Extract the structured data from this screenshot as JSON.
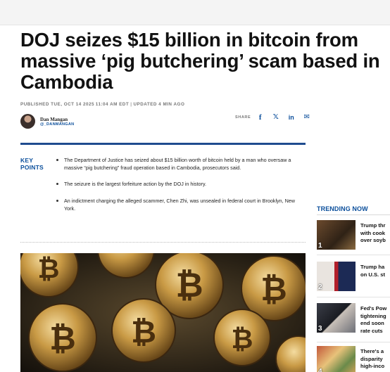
{
  "article": {
    "headline": "DOJ seizes $15 billion in bitcoin from massive ‘pig butchering’ scam based in Cambodia",
    "published": "PUBLISHED TUE, OCT 14 2025 11:04 AM EDT",
    "updated": "UPDATED 4 MIN AGO",
    "author_name": "Dan Mangan",
    "author_handle": "@_DANMANGAN",
    "share_label": "SHARE",
    "key_points_label_line1": "KEY",
    "key_points_label_line2": "POINTS",
    "key_points": [
      "The Department of Justice has seized about $15 billion worth of bitcoin held by a man who oversaw a massive “pig butchering” fraud operation based in Cambodia, prosecutors said.",
      "The seizure is the largest forfeiture action by the DOJ in history.",
      "An indictment charging the alleged scammer, Chen Zhi, was unsealed in federal court in Brooklyn, New York."
    ]
  },
  "share_icons": {
    "facebook": "f",
    "x": "𝕏",
    "linkedin": "in",
    "email": "✉"
  },
  "trending": {
    "title": "TRENDING NOW",
    "items": [
      {
        "num": "1",
        "lines": [
          "Trump thr",
          "with cook",
          "over soyb"
        ]
      },
      {
        "num": "2",
        "lines": [
          "Trump ha",
          "on U.S. st"
        ]
      },
      {
        "num": "3",
        "lines": [
          "Fed's Pow",
          "tightening",
          "end soon",
          "rate cuts"
        ]
      },
      {
        "num": "4",
        "lines": [
          "There's a",
          "disparity",
          "high-inco"
        ]
      }
    ]
  },
  "colors": {
    "brand_blue": "#0a4e9b",
    "rule_blue": "#1f4c8f"
  }
}
